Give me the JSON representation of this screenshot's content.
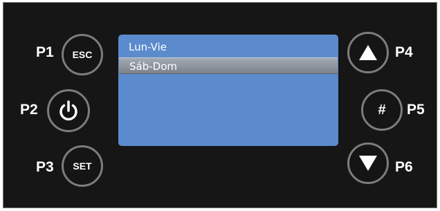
{
  "display": {
    "options": [
      {
        "label": "Lun-Vie",
        "selected": false
      },
      {
        "label": "Sáb-Dom",
        "selected": true
      }
    ]
  },
  "buttons": {
    "p1": {
      "label": "P1",
      "text": "ESC"
    },
    "p2": {
      "label": "P2",
      "icon": "power-icon"
    },
    "p3": {
      "label": "P3",
      "text": "SET"
    },
    "p4": {
      "label": "P4",
      "icon": "arrow-up-icon"
    },
    "p5": {
      "label": "P5",
      "text": "#"
    },
    "p6": {
      "label": "P6",
      "icon": "arrow-down-icon"
    }
  },
  "colors": {
    "panel": "#161616",
    "button_ring": "#7d7d7d",
    "screen": "#5b8bcc",
    "selection": "#8d949c"
  }
}
